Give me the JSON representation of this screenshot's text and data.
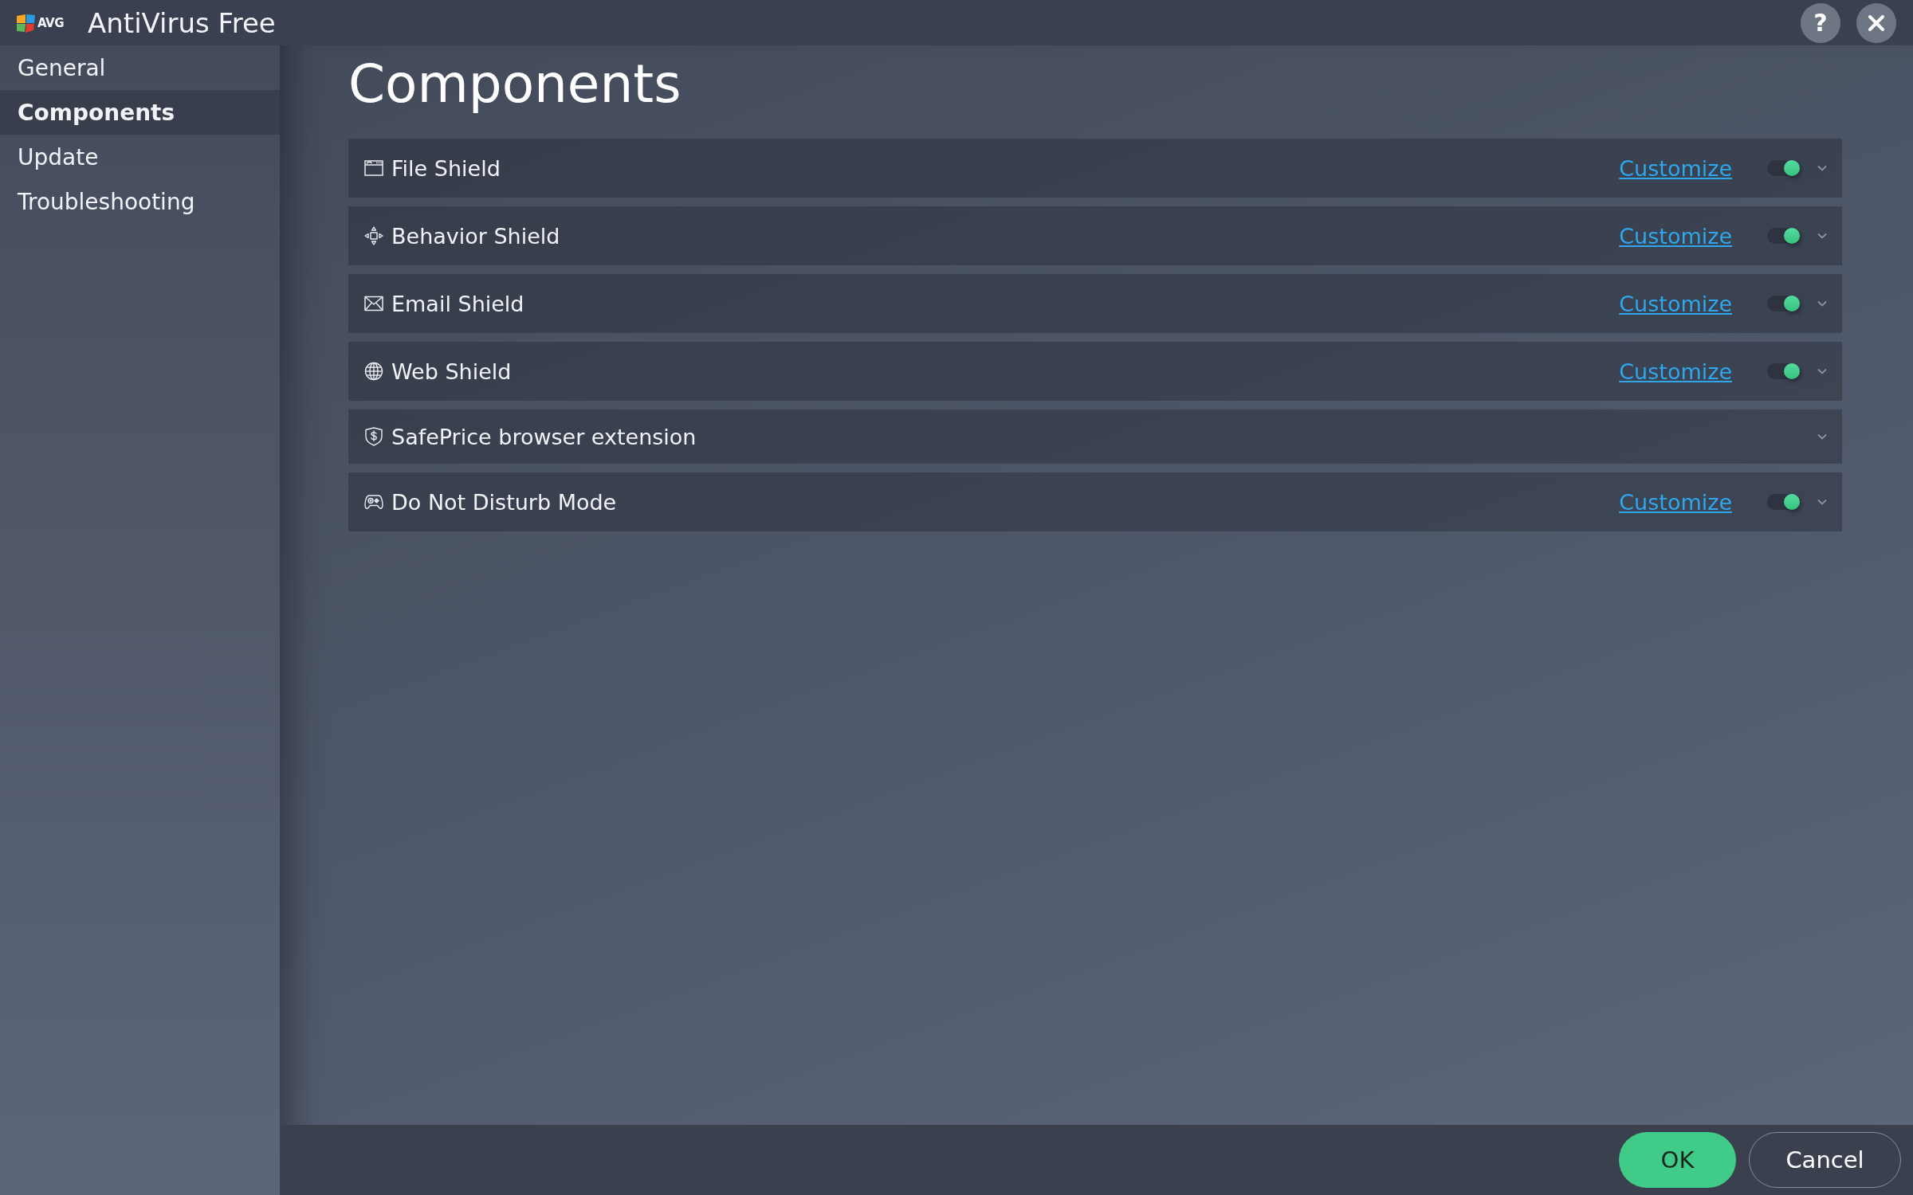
{
  "window": {
    "logo_text": "AVG",
    "title": "AntiVirus Free",
    "help_label": "?"
  },
  "sidebar": {
    "items": [
      {
        "label": "General",
        "selected": false
      },
      {
        "label": "Components",
        "selected": true
      },
      {
        "label": "Update",
        "selected": false
      },
      {
        "label": "Troubleshooting",
        "selected": false
      }
    ]
  },
  "page": {
    "heading": "Components"
  },
  "components": [
    {
      "name": "File Shield",
      "customize": "Customize",
      "on": true,
      "expanded": false
    },
    {
      "name": "Behavior Shield",
      "customize": "Customize",
      "on": true,
      "expanded": false
    },
    {
      "name": "Email Shield",
      "customize": "Customize",
      "on": true,
      "expanded": false
    },
    {
      "name": "Web Shield",
      "customize": "Customize",
      "on": true,
      "expanded": false
    },
    {
      "name": "SafePrice browser extension",
      "expanded": false
    },
    {
      "name": "Do Not Disturb Mode",
      "customize": "Customize",
      "on": true,
      "expanded": false
    }
  ],
  "footer": {
    "buttons": [
      {
        "label": "OK",
        "kind": "primary"
      },
      {
        "label": "Cancel",
        "kind": "secondary"
      }
    ]
  }
}
